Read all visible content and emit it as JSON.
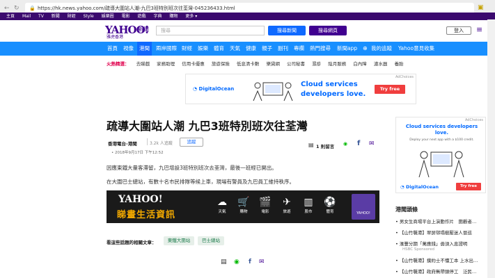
{
  "browser": {
    "url": "https://hk.news.yahoo.com/疏導大圍站人潮-九巴3班特別班次往荃灣-045236433.html",
    "bookmarks": [
      "主頁",
      "Mail",
      "TV",
      "新聞",
      "財經",
      "Style",
      "娛樂圈",
      "電影",
      "遊戲",
      "字典",
      "購物",
      "更多 ▾"
    ]
  },
  "header": {
    "logo": "YAHOO!",
    "logo_sub": "雅虎香港",
    "section": "新聞",
    "search_placeholder": "搜尋",
    "search_news_btn": "搜尋新聞",
    "search_web_btn": "搜尋網頁",
    "login": "登入"
  },
  "nav": {
    "items": [
      "首頁",
      "視像",
      "港聞",
      "兩岸國際",
      "財經",
      "娛樂",
      "體育",
      "天氣",
      "健康",
      "親子",
      "副刊",
      "專欄",
      "熱門搜尋",
      "新聞app",
      "我的追蹤",
      "Yahoo意見收集"
    ],
    "active": "港聞"
  },
  "hot": {
    "label": "火熱精選：",
    "items": [
      "去睇戲",
      "家務助理",
      "信用卡優惠",
      "旅遊保險",
      "低息清卡數",
      "樂貸網",
      "公司秘書",
      "濕疹",
      "陰月服務",
      "白內障",
      "濾水器",
      "養胎"
    ]
  },
  "ad_top": {
    "badge": "AdChoices",
    "brand": "DigitalOcean",
    "headline_1": "Cloud services",
    "headline_2": "developers love.",
    "cta": "Try free"
  },
  "article": {
    "title": "疏導大圍站人潮 九巴3班特別班次往荃灣",
    "source": "香港電台-港聞",
    "followers": "3.2k 人追蹤",
    "follow": "追蹤",
    "date": "• 2018年9月17日 下午12:52",
    "comments": "1 則留言",
    "p1": "因應東鐵大量客滯留，九巴增設3班特別班次去荃灣，最後一班經已開出。",
    "p2": "在大圍巴士總站，有數十名市民排隊等候上車，現場有警員及九巴員工維持秩序。"
  },
  "banner": {
    "yahoo": "YAHOO!",
    "tagline": "睇畫生活資訊",
    "icons": [
      {
        "name": "weather-icon",
        "glyph": "☁",
        "label": "天氣"
      },
      {
        "name": "shopping-icon",
        "glyph": "🛒",
        "label": "購物"
      },
      {
        "name": "movie-icon",
        "glyph": "🎬",
        "label": "電影"
      },
      {
        "name": "travel-icon",
        "glyph": "✈",
        "label": "旅遊"
      },
      {
        "name": "stocks-icon",
        "glyph": "▥",
        "label": "股市"
      },
      {
        "name": "sports-icon",
        "glyph": "⚽",
        "label": "體育"
      }
    ],
    "logo": "YAHOO!"
  },
  "related": {
    "label": "看這些話題的相關文章：",
    "tags": [
      "東鐵大圍站",
      "巴士總站"
    ]
  },
  "side_ad": {
    "badge": "AdChoices",
    "headline_1": "Cloud services developers love.",
    "subline": "Deploy your next app with a $100 credit.",
    "brand": "DigitalOcean",
    "cta": "Try free"
  },
  "side_hot": {
    "heading": "港聞頭條",
    "items": [
      {
        "text": "男女生商場平台上演動作片　圍觀者…",
        "tag": ""
      },
      {
        "text": "【山竹襲港】翠屏邨塌樹壓迷人晉巡",
        "tag": "【山竹襲港】"
      },
      {
        "text": "滙豐分期「萬應錢」毋須入息證明",
        "tag": ""
      },
      {
        "text": "HSBC Sponsored",
        "tag": "sponsor"
      },
      {
        "text": "【山竹襲港】撲約士不懂工本 上水出…",
        "tag": "【山竹襲港】"
      },
      {
        "text": "【山竹襲港】政府無帶頭停工　泛民…",
        "tag": "【山竹襲港】"
      }
    ]
  }
}
